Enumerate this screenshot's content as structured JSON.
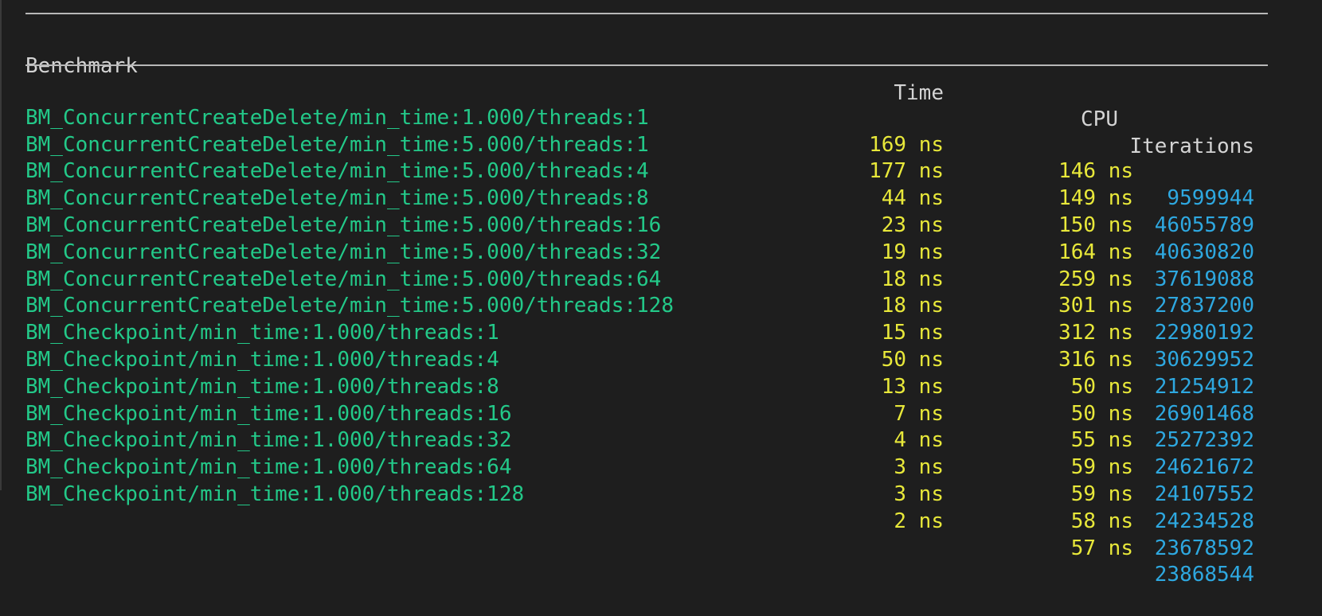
{
  "header": {
    "benchmark": "Benchmark",
    "time": "Time",
    "cpu": "CPU",
    "iterations": "Iterations"
  },
  "rows": [
    {
      "name": "BM_ConcurrentCreateDelete/min_time:1.000/threads:1",
      "time": "169 ns",
      "cpu": "146 ns",
      "iterations": "9599944"
    },
    {
      "name": "BM_ConcurrentCreateDelete/min_time:5.000/threads:1",
      "time": "177 ns",
      "cpu": "149 ns",
      "iterations": "46055789"
    },
    {
      "name": "BM_ConcurrentCreateDelete/min_time:5.000/threads:4",
      "time": "44 ns",
      "cpu": "150 ns",
      "iterations": "40630820"
    },
    {
      "name": "BM_ConcurrentCreateDelete/min_time:5.000/threads:8",
      "time": "23 ns",
      "cpu": "164 ns",
      "iterations": "37619088"
    },
    {
      "name": "BM_ConcurrentCreateDelete/min_time:5.000/threads:16",
      "time": "19 ns",
      "cpu": "259 ns",
      "iterations": "27837200"
    },
    {
      "name": "BM_ConcurrentCreateDelete/min_time:5.000/threads:32",
      "time": "18 ns",
      "cpu": "301 ns",
      "iterations": "22980192"
    },
    {
      "name": "BM_ConcurrentCreateDelete/min_time:5.000/threads:64",
      "time": "18 ns",
      "cpu": "312 ns",
      "iterations": "30629952"
    },
    {
      "name": "BM_ConcurrentCreateDelete/min_time:5.000/threads:128",
      "time": "15 ns",
      "cpu": "316 ns",
      "iterations": "21254912"
    },
    {
      "name": "BM_Checkpoint/min_time:1.000/threads:1",
      "time": "50 ns",
      "cpu": "50 ns",
      "iterations": "26901468"
    },
    {
      "name": "BM_Checkpoint/min_time:1.000/threads:4",
      "time": "13 ns",
      "cpu": "50 ns",
      "iterations": "25272392"
    },
    {
      "name": "BM_Checkpoint/min_time:1.000/threads:8",
      "time": "7 ns",
      "cpu": "55 ns",
      "iterations": "24621672"
    },
    {
      "name": "BM_Checkpoint/min_time:1.000/threads:16",
      "time": "4 ns",
      "cpu": "59 ns",
      "iterations": "24107552"
    },
    {
      "name": "BM_Checkpoint/min_time:1.000/threads:32",
      "time": "3 ns",
      "cpu": "59 ns",
      "iterations": "24234528"
    },
    {
      "name": "BM_Checkpoint/min_time:1.000/threads:64",
      "time": "3 ns",
      "cpu": "58 ns",
      "iterations": "23678592"
    },
    {
      "name": "BM_Checkpoint/min_time:1.000/threads:128",
      "time": "2 ns",
      "cpu": "57 ns",
      "iterations": "23868544"
    }
  ],
  "colors": {
    "background": "#1e1e1e",
    "name": "#23c989",
    "numbers": "#e8e83a",
    "iterations": "#2ea8e0",
    "header": "#d4d4d4",
    "rule": "#b8b8b8"
  }
}
